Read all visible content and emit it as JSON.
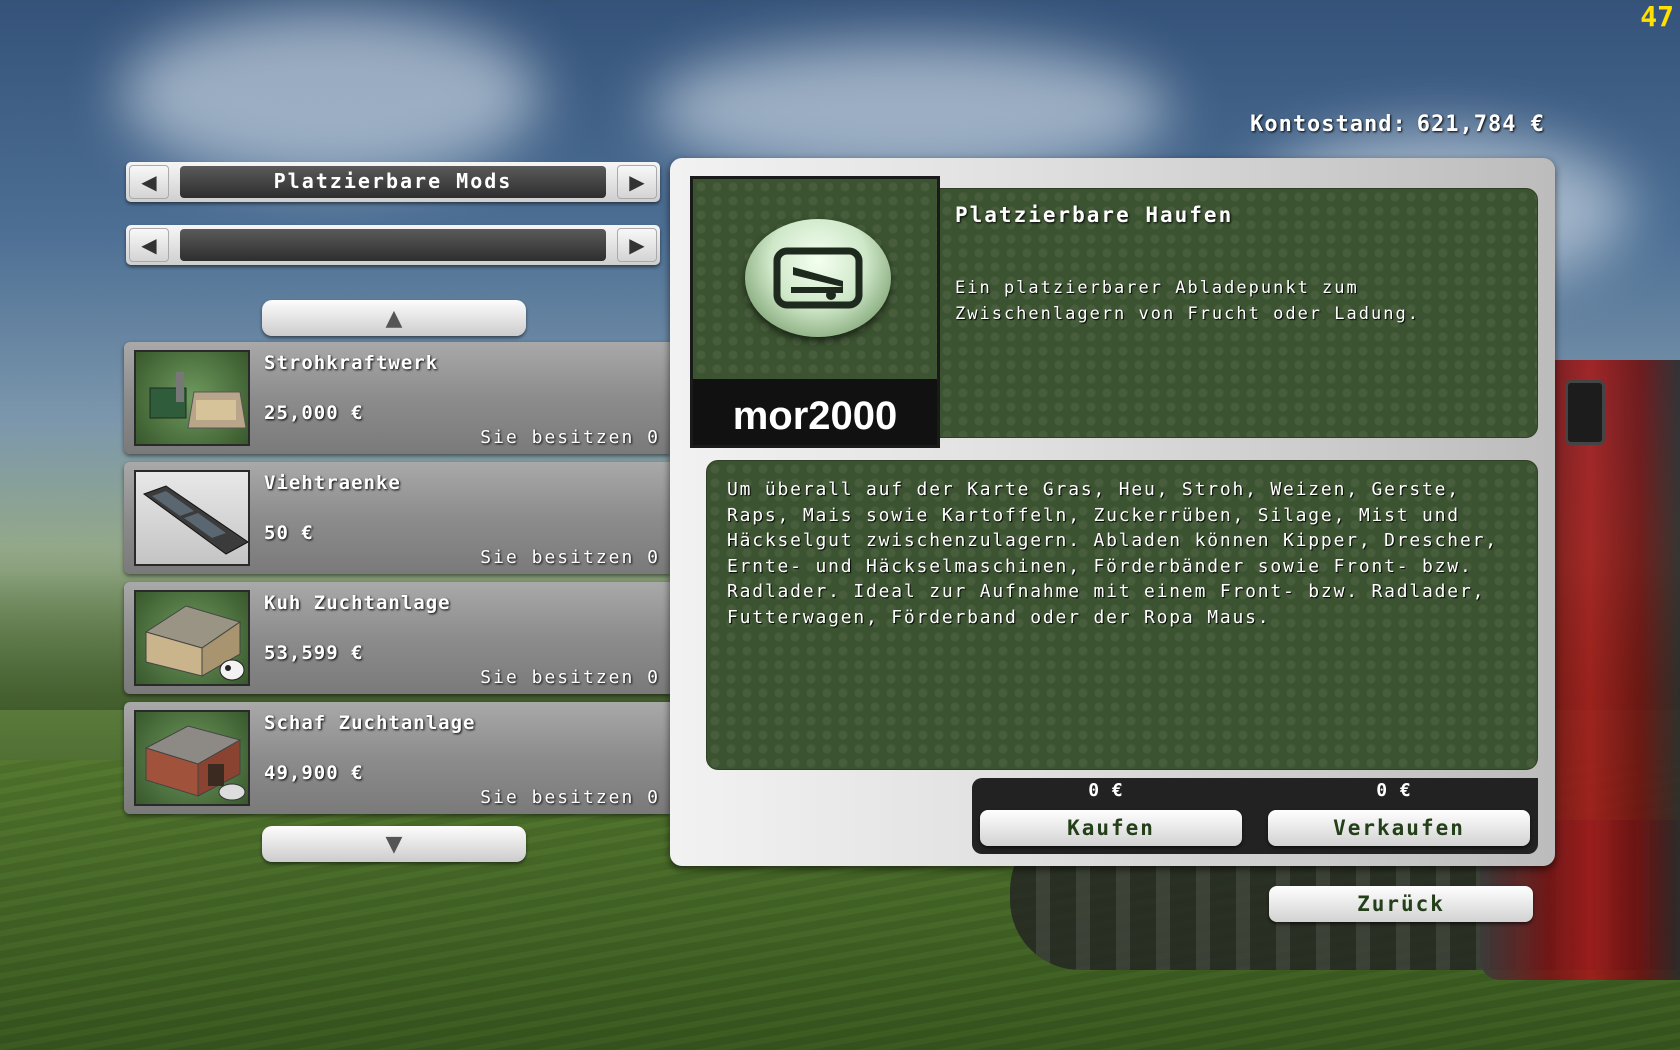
{
  "hud": {
    "fps": "47"
  },
  "header": {
    "balance_label": "Kontostand:",
    "balance_value": "621,784 €"
  },
  "category_selector": {
    "label": "Platzierbare Mods"
  },
  "subcategory_selector": {
    "label": ""
  },
  "shop_items": [
    {
      "name": "Strohkraftwerk",
      "price": "25,000 €",
      "owned": "Sie besitzen 0"
    },
    {
      "name": "Viehtraenke",
      "price": "50 €",
      "owned": "Sie besitzen 0"
    },
    {
      "name": "Kuh Zuchtanlage",
      "price": "53,599 €",
      "owned": "Sie besitzen 0"
    },
    {
      "name": "Schaf Zuchtanlage",
      "price": "49,900 €",
      "owned": "Sie besitzen 0"
    }
  ],
  "detail": {
    "author": "mor2000",
    "title": "Platzierbare Haufen",
    "short_description": "Ein platzierbarer Abladepunkt zum Zwischenlagern von Frucht oder Ladung.",
    "long_description": "Um überall auf der Karte Gras, Heu, Stroh, Weizen, Gerste, Raps, Mais sowie Kartoffeln, Zuckerrüben, Silage, Mist und Häckselgut zwischenzulagern. Abladen können Kipper, Drescher, Ernte- und Häckselmaschinen, Förderbänder sowie Front- bzw. Radlader. Ideal zur Aufnahme mit einem Front- bzw. Radlader, Futterwagen, Förderband oder der Ropa Maus.",
    "buy_price": "0 €",
    "sell_price": "0 €",
    "buy_label": "Kaufen",
    "sell_label": "Verkaufen"
  },
  "footer": {
    "back_label": "Zurück"
  },
  "colors": {
    "panel_green": "#3b5330",
    "button_text": "#24401a",
    "fps_yellow": "#ffe000"
  },
  "icons": [
    "arrow-left-icon",
    "arrow-right-icon",
    "arrow-up-icon",
    "arrow-down-icon",
    "trailer-icon"
  ]
}
